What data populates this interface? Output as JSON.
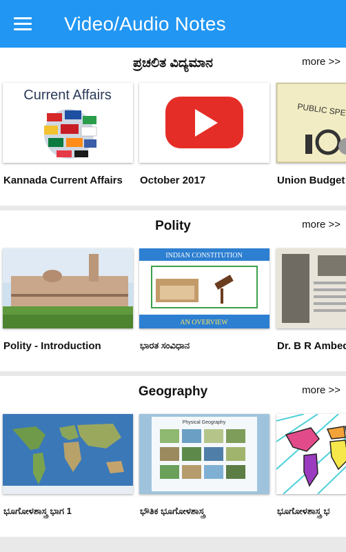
{
  "app": {
    "title": "Video/Audio Notes"
  },
  "sections": [
    {
      "title": "ಪ್ರಚಲಿತ ವಿದ್ಯಮಾನ",
      "more": "more >>",
      "items": [
        {
          "label": "Kannada Current Affairs",
          "thumb_text": "Current Affairs"
        },
        {
          "label": "October 2017"
        },
        {
          "label": "Union Budget",
          "thumb_text": "PUBLIC SPENDING"
        }
      ]
    },
    {
      "title": "Polity",
      "more": "more >>",
      "items": [
        {
          "label": "Polity - Introduction"
        },
        {
          "label": "ಭಾರತ ಸಂವಿಧಾನ",
          "thumb_text": "INDIAN CONSTITUTION",
          "thumb_subtext": "AN OVERVIEW"
        },
        {
          "label": "Dr. B R Ambed"
        }
      ]
    },
    {
      "title": "Geography",
      "more": "more >>",
      "items": [
        {
          "label": "ಭೂಗೋಳಶಾಸ್ತ್ರ ಭಾಗ 1"
        },
        {
          "label": "ಭೌತಿಕ ಭೂಗೋಳಶಾಸ್ತ್ರ",
          "thumb_text": "Physical Geography"
        },
        {
          "label": "ಭೂಗೋಳಶಾಸ್ತ್ರ ಭ"
        }
      ]
    }
  ],
  "colors": {
    "appbar": "#2196f3",
    "youtube_red": "#e52d27"
  },
  "icons": [
    "menu-icon",
    "youtube-play-icon"
  ]
}
